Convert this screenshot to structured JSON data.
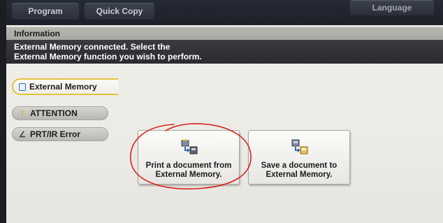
{
  "top_tabs": {
    "program": "Program",
    "quick_copy": "Quick Copy",
    "language": "Language"
  },
  "info": {
    "title": "Information",
    "message_line1": "External Memory connected. Select the",
    "message_line2": "External Memory function you wish to perform."
  },
  "sidebar": {
    "items": [
      {
        "label": "External Memory",
        "icon": "external-memory-icon"
      },
      {
        "label": "ATTENTION",
        "icon": "warning-icon"
      },
      {
        "label": "PRT/IR Error",
        "icon": "printer-error-icon"
      }
    ]
  },
  "functions": {
    "print": {
      "line1": "Print a document from",
      "line2": "External Memory.",
      "icon": "print-from-memory-icon"
    },
    "save": {
      "line1": "Save a document to",
      "line2": "External Memory.",
      "icon": "save-to-memory-icon"
    }
  },
  "colors": {
    "accent_highlight": "#e2c23a",
    "annotation_red": "#d8231d",
    "message_bar": "#2f3035"
  }
}
